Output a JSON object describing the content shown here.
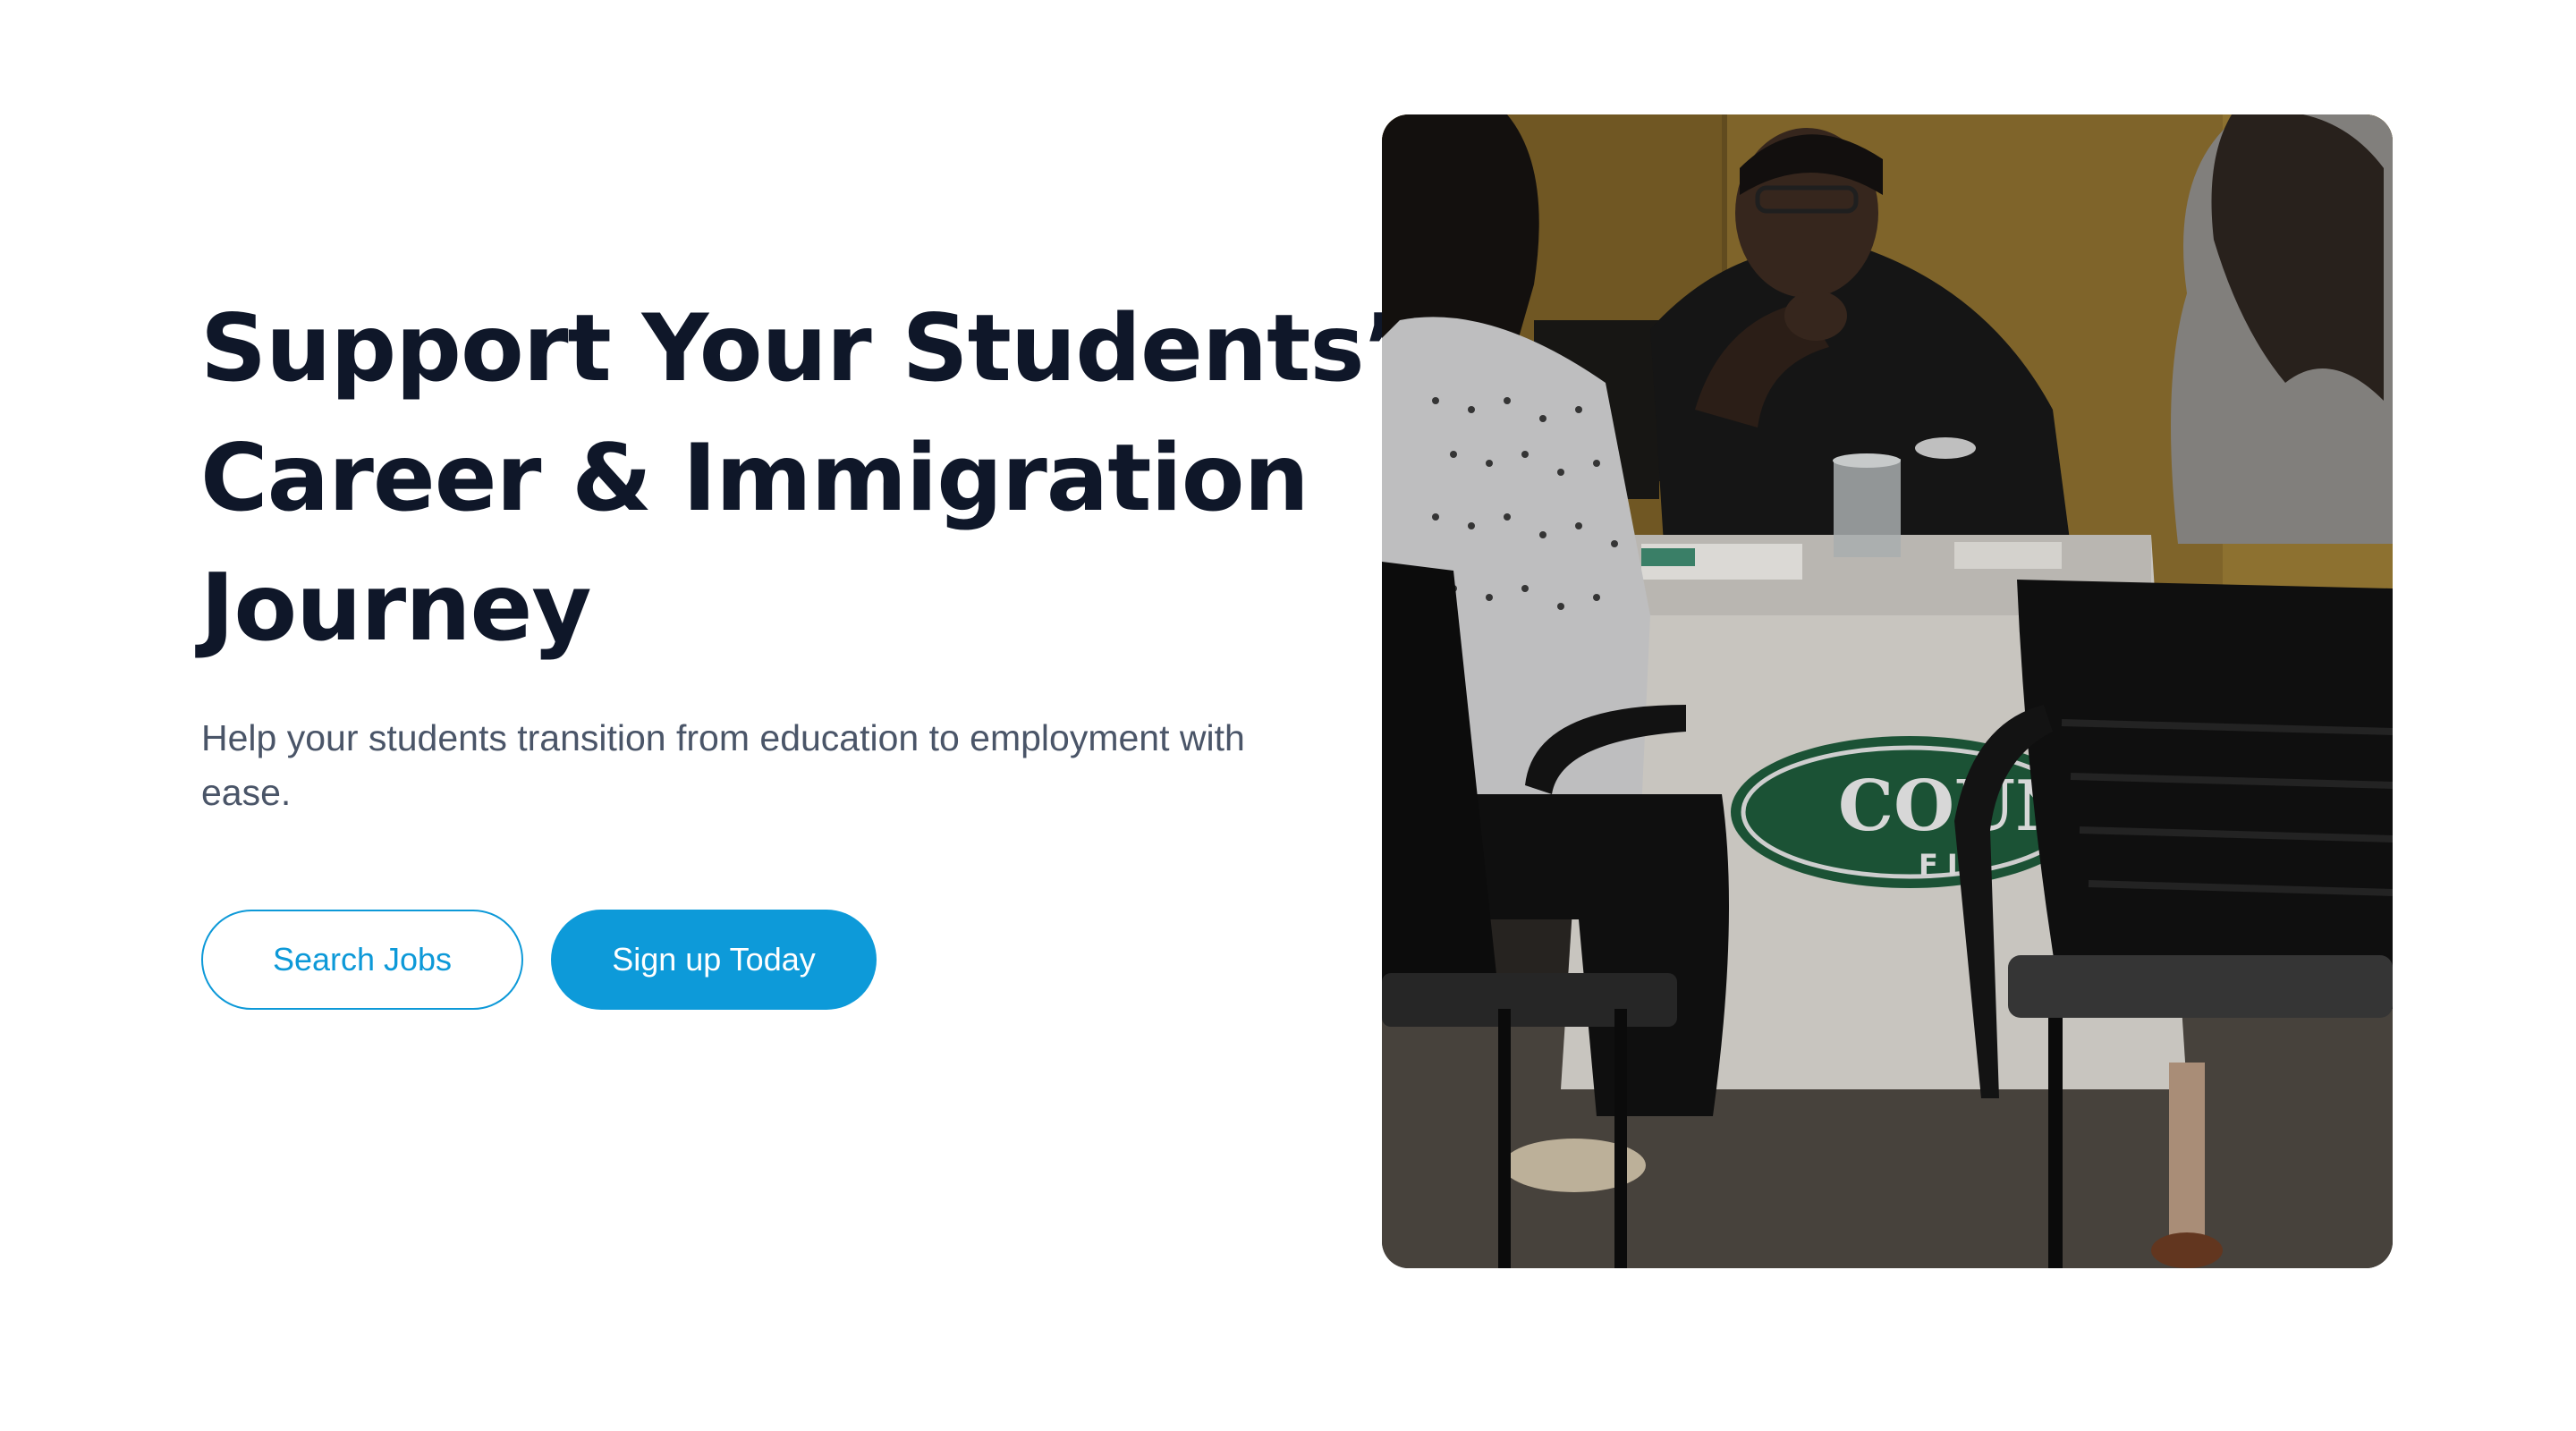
{
  "hero": {
    "title_lines": [
      "Support Your Students’",
      "Career & Immigration",
      "Journey"
    ],
    "subtitle": "Help your students transition from education to employment with ease.",
    "buttons": {
      "search_jobs": "Search Jobs",
      "sign_up": "Sign up Today"
    }
  },
  "photo": {
    "subject": "career-fair-table-conversation",
    "tablecloth_logo_text": "COUN",
    "tablecloth_logo_subtext": "FIN"
  },
  "colors": {
    "heading": "#0f1729",
    "body_text": "#4a5568",
    "accent": "#0d9ad9",
    "background": "#ffffff"
  }
}
